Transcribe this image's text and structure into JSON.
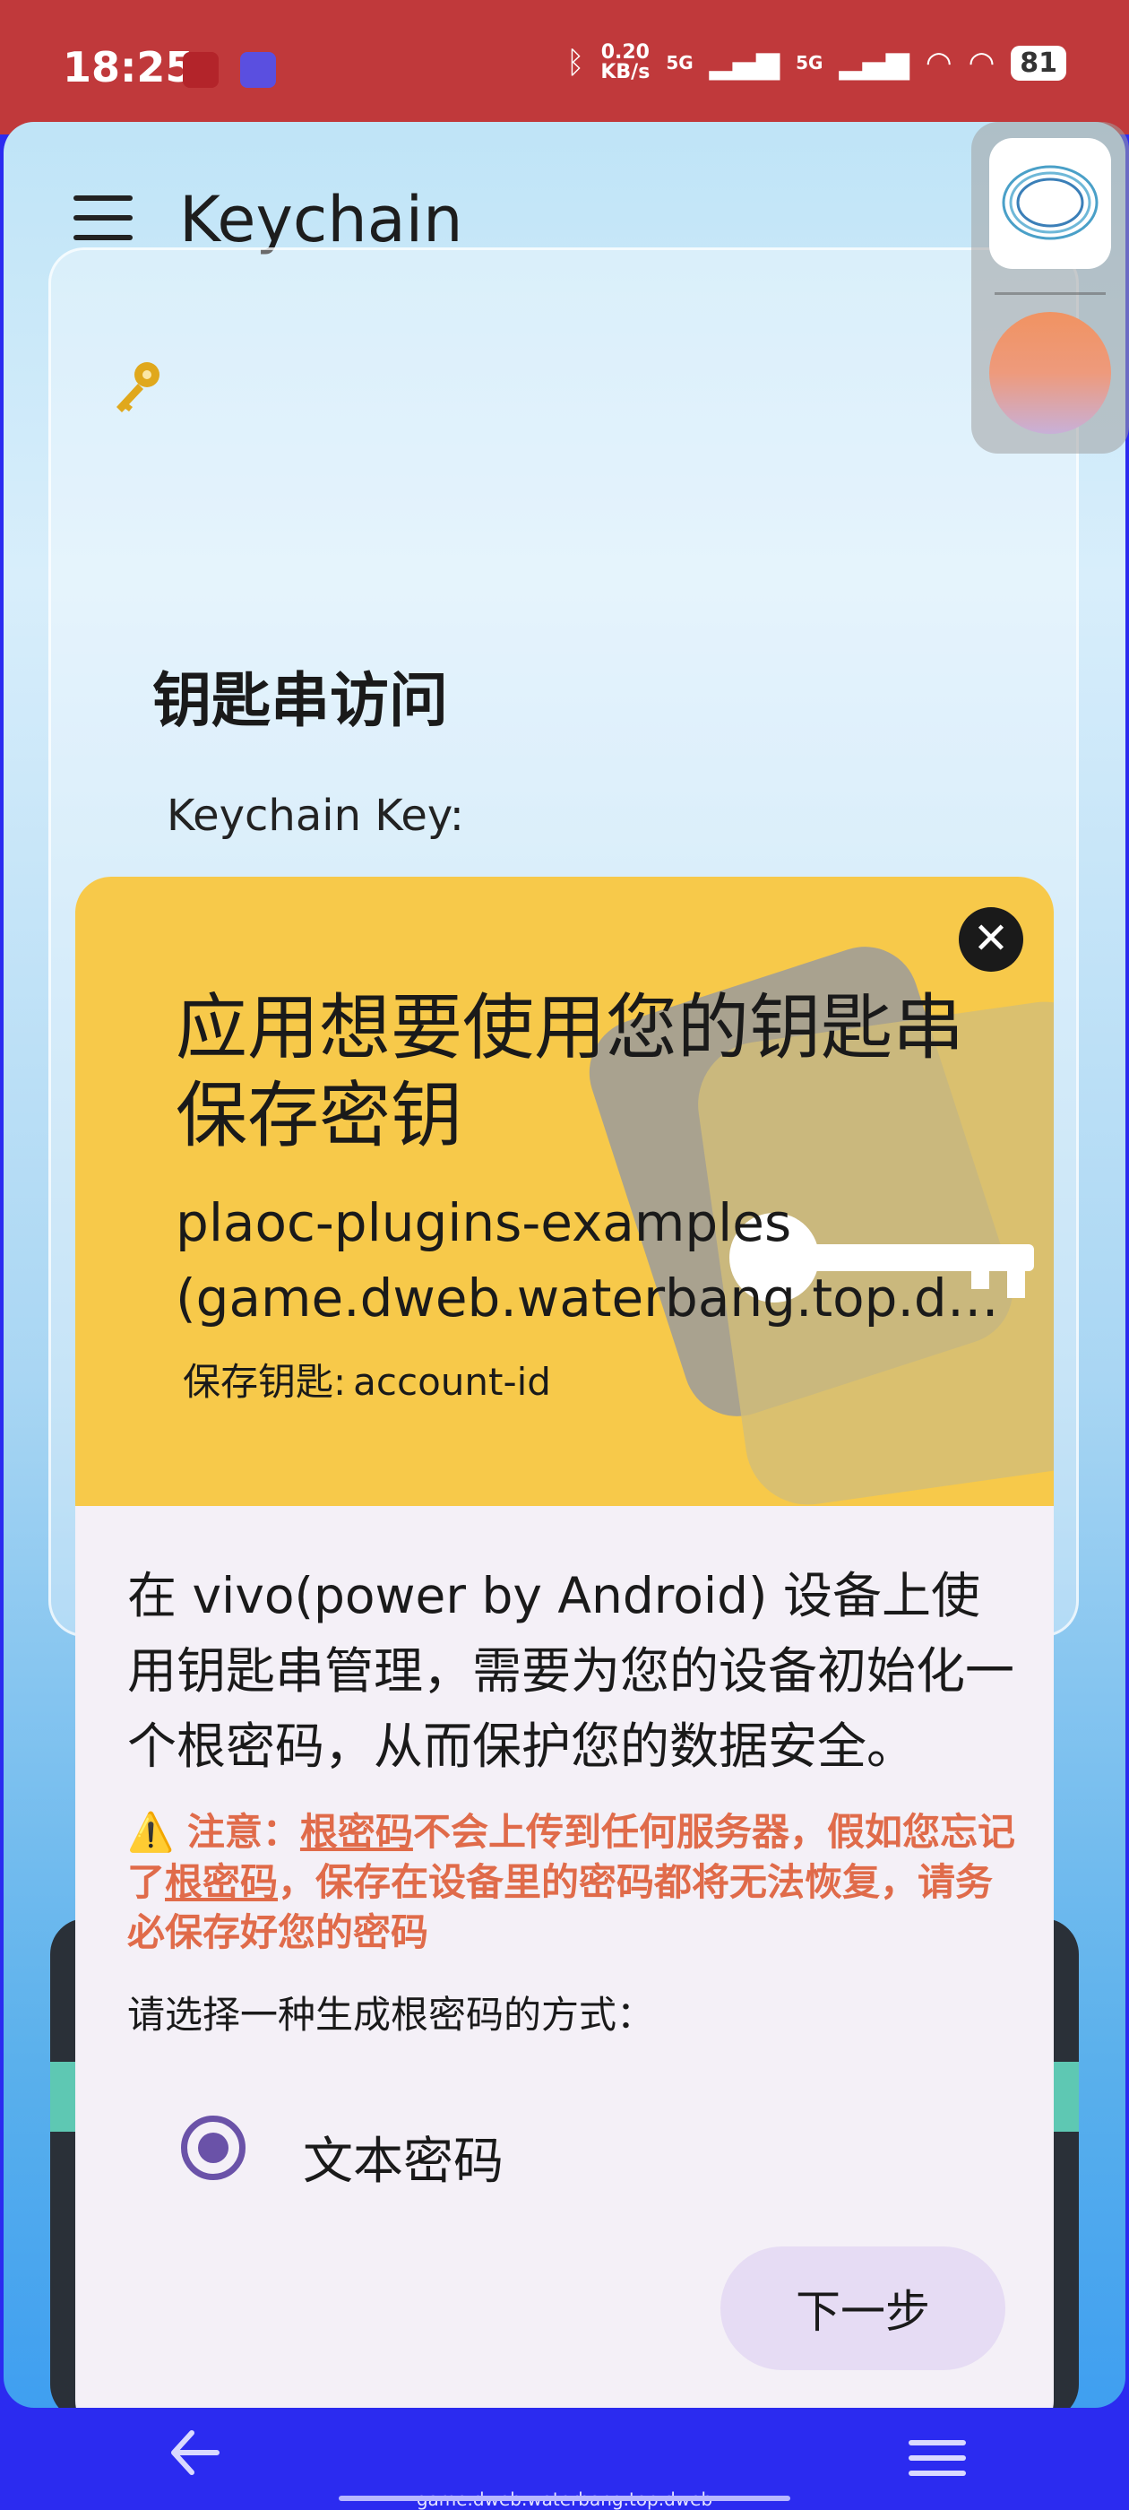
{
  "status_bar": {
    "time": "18:25",
    "speed": "0.20",
    "speed_unit": "KB/s",
    "net1": "5G",
    "net2": "5G",
    "battery": "81",
    "icons": [
      "bluetooth-icon",
      "signal-icon",
      "wifi-icon",
      "battery-icon"
    ]
  },
  "app": {
    "title": "Keychain",
    "card": {
      "heading": "钥匙串访问",
      "key_label": "Keychain Key:"
    }
  },
  "dialog": {
    "close_symbol": "✕",
    "title": "应用想要使用您的钥匙串保存密钥",
    "app_name": "plaoc-plugins-examples",
    "app_id": "(game.dweb.waterbang.top.dweb)",
    "save_key_label": "保存钥匙:",
    "save_key_value": "account-id",
    "body": "在 vivo(power by Android) 设备上使用钥匙串管理，需要为您的设备初始化一个根密码，从而保护您的数据安全。",
    "warning": {
      "prefix": "⚠️ 注意：",
      "term1": "根密码",
      "mid1": "不会上传到任何服务器，假如您忘记了",
      "term2": "根密码",
      "rest": "，保存在设备里的密码都将无法恢复，请务必保存好您的密码"
    },
    "choose_label": "请选择一种生成根密码的方式：",
    "option_label": "文本密码",
    "next_label": "下一步"
  },
  "nav_bar": {
    "url": "game.dweb.waterbang.top.dweb"
  },
  "colors": {
    "status_bar": "#c0393b",
    "dialog_header": "#f7c94a",
    "accent": "#6a52a8",
    "warning": "#e06b4a",
    "nav_bar": "#2b2bf0"
  }
}
